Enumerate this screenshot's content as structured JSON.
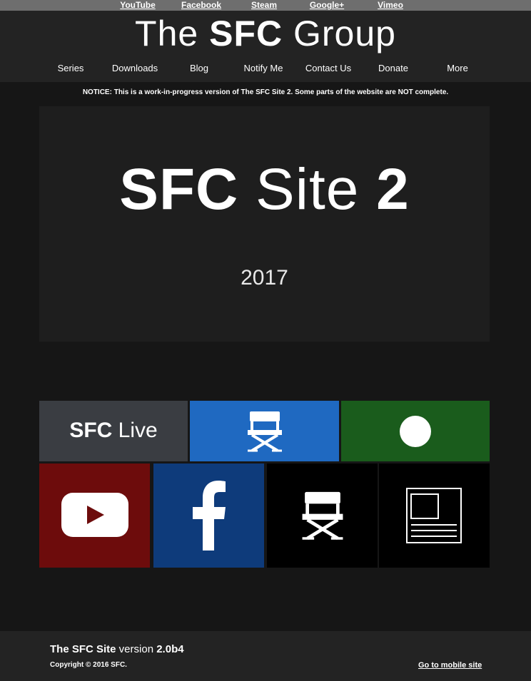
{
  "social_links": [
    "YouTube",
    "Facebook",
    "Steam",
    "Google+",
    "Vimeo"
  ],
  "brand": {
    "prefix": "The ",
    "highlight": "SFC",
    "suffix": " Group"
  },
  "nav": [
    "Series",
    "Downloads",
    "Blog",
    "Notify Me",
    "Contact Us",
    "Donate",
    "More"
  ],
  "notice": "NOTICE: This is a work-in-progress version of The SFC Site 2. Some parts of the website are NOT complete.",
  "hero": {
    "title_bold": "SFC",
    "title_light": " Site ",
    "title_num": "2",
    "year": "2017"
  },
  "tiles": {
    "live_bold": "SFC",
    "live_light": " Live",
    "icons": [
      "director-chair-icon",
      "circle-icon",
      "youtube-icon",
      "facebook-icon",
      "director-chair-icon",
      "news-icon"
    ]
  },
  "colors": {
    "live": "#3a3d42",
    "series_blue": "#1f69c1",
    "green": "#1a5c1c",
    "youtube": "#6d0c0c",
    "facebook": "#0e3b7b",
    "black": "#000000"
  },
  "footer": {
    "site_bold": "The SFC Site",
    "version_label": " version ",
    "version": "2.0b4",
    "copyright": "Copyright © 2016 SFC.",
    "mobile_link": "Go to mobile site"
  }
}
